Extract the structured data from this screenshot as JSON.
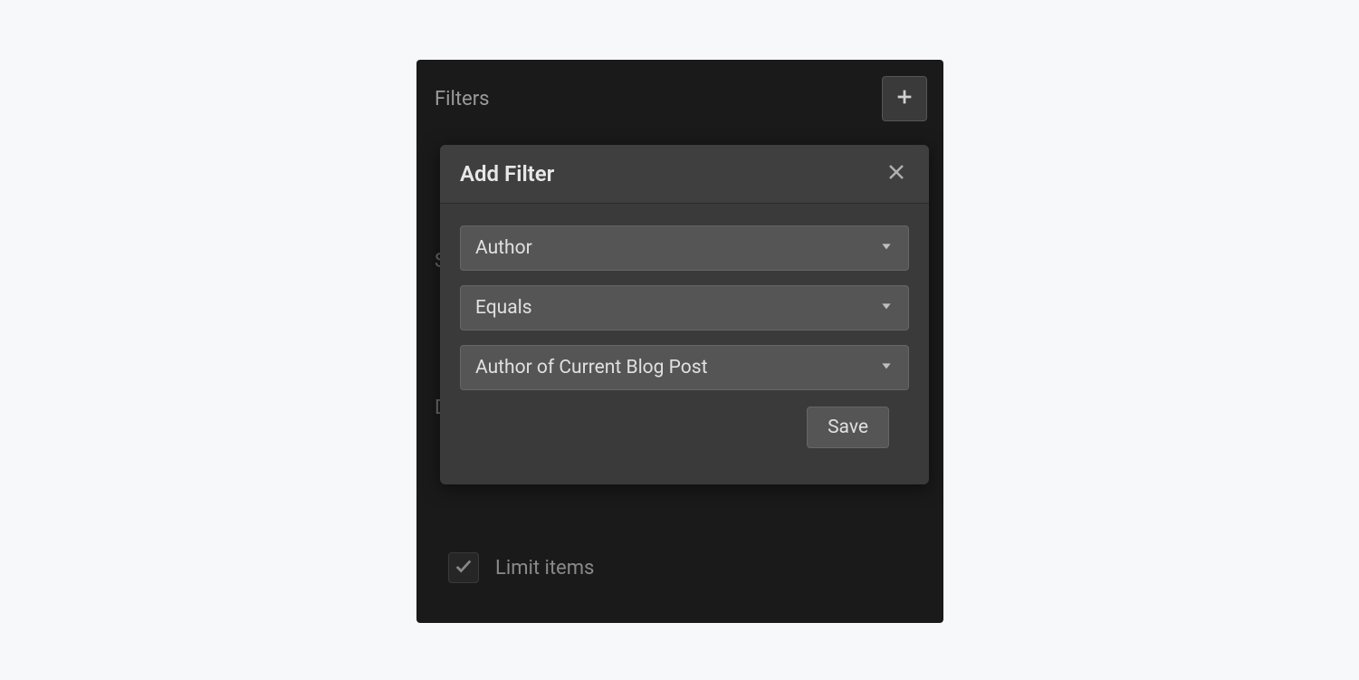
{
  "panel": {
    "title": "Filters",
    "bg_labels": {
      "s": "S",
      "d": "D"
    },
    "limit_items": {
      "label": "Limit items",
      "checked": true
    }
  },
  "modal": {
    "title": "Add Filter",
    "fields": {
      "field1": "Author",
      "field2": "Equals",
      "field3": "Author of Current Blog Post"
    },
    "save_label": "Save"
  }
}
